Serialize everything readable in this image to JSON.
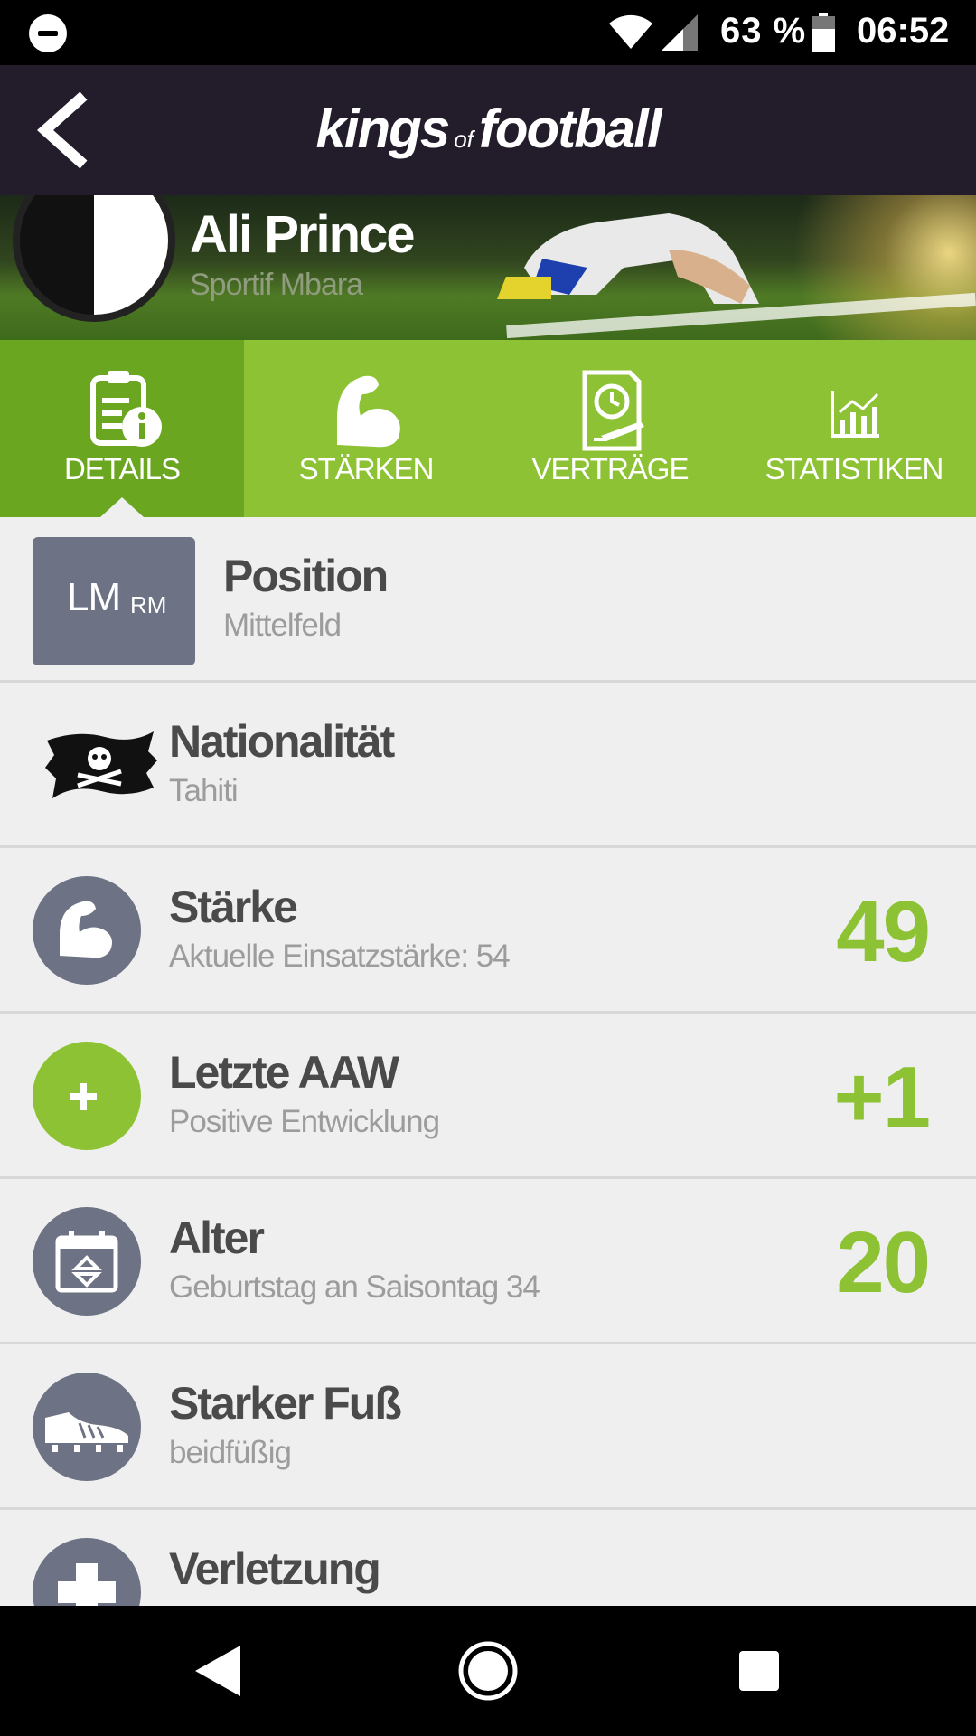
{
  "status_bar": {
    "battery_percent": "63 %",
    "time": "06:52",
    "icons": [
      "do-not-disturb-icon",
      "wifi-icon",
      "signal-icon",
      "battery-icon"
    ]
  },
  "header": {
    "brand_part1": "kings",
    "brand_part2": "of",
    "brand_part3": "football",
    "back_icon": "chevron-left-icon"
  },
  "player": {
    "name": "Ali Prince",
    "club": "Sportif Mbara"
  },
  "tabs": [
    {
      "label": "DETAILS",
      "icon": "clipboard-info-icon",
      "active": true
    },
    {
      "label": "STÄRKEN",
      "icon": "flexed-arm-icon",
      "active": false
    },
    {
      "label": "VERTRÄGE",
      "icon": "contract-clock-icon",
      "active": false
    },
    {
      "label": "STATISTIKEN",
      "icon": "bar-chart-icon",
      "active": false
    }
  ],
  "details": {
    "position": {
      "badge_main": "LM",
      "badge_sub": "RM",
      "title": "Position",
      "subtitle": "Mittelfeld"
    },
    "nationality": {
      "title": "Nationalität",
      "subtitle": "Tahiti",
      "icon": "pirate-flag-icon"
    },
    "strength": {
      "title": "Stärke",
      "subtitle": "Aktuelle Einsatzstärke: 54",
      "value": "49",
      "icon": "flexed-arm-icon"
    },
    "last_aaw": {
      "title": "Letzte AAW",
      "subtitle": "Positive Entwicklung",
      "value": "+1",
      "icon": "plus-icon"
    },
    "age": {
      "title": "Alter",
      "subtitle": "Geburtstag an Saisontag 34",
      "value": "20",
      "icon": "calendar-icon"
    },
    "strong_foot": {
      "title": "Starker Fuß",
      "subtitle": "beidfüßig",
      "icon": "football-boot-icon"
    },
    "injury": {
      "title": "Verletzung",
      "icon": "medical-cross-icon"
    }
  },
  "colors": {
    "accent_green": "#8dc234",
    "active_tab": "#6ba620",
    "header_bg": "#231c2a",
    "icon_circle": "#6d7385"
  }
}
